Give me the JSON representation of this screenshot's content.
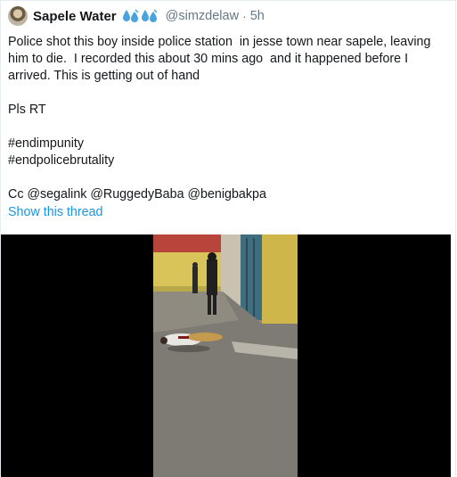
{
  "tweet": {
    "display_name": "Sapele Water",
    "name_emoji": [
      "sweat-droplets-emoji",
      "sweat-droplets-emoji"
    ],
    "handle": "@simzdelaw",
    "separator": "·",
    "time": "5h",
    "body_lines": [
      "Police shot this boy inside police station  in jesse town near sapele, leaving him to die.  I recorded this about 30 mins ago  and it happened before I arrived. This is getting out of hand",
      "Pls RT",
      "#endimpunity",
      "#endpolicebrutality",
      "Cc @segalink @RuggedyBaba @benigbakpa"
    ],
    "show_thread_label": "Show this thread"
  },
  "media": {
    "type": "video-still",
    "background": "#000000"
  },
  "colors": {
    "link": "#1b95e0",
    "secondary": "#657786",
    "text": "#14171a",
    "emoji_drop": "#4aa3df"
  }
}
